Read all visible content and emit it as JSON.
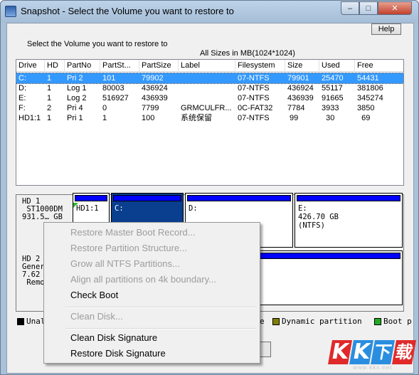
{
  "window": {
    "title": "Snapshot - Select the Volume you want to restore to",
    "minimize": "–",
    "maximize": "□",
    "close": "✕"
  },
  "help_label": "Help",
  "subtitle": "Select the Volume you want to restore to",
  "sizes_note": "All Sizes in MB(1024*1024)",
  "columns": [
    "Drive",
    "HD",
    "PartNo",
    "PartSt...",
    "PartSize",
    "Label",
    "Filesystem",
    "Size",
    "Used",
    "Free"
  ],
  "rows": [
    [
      "C:",
      "1",
      "Pri  2",
      "101",
      "79902",
      "",
      "07-NTFS",
      "79901",
      "25470",
      "54431"
    ],
    [
      "D:",
      "1",
      "Log  1",
      "80003",
      "436924",
      "",
      "07-NTFS",
      "436924",
      "55117",
      "381806"
    ],
    [
      "E:",
      "1",
      "Log  2",
      "516927",
      "436939",
      "",
      "07-NTFS",
      "436939",
      "91665",
      "345274"
    ],
    [
      "F:",
      "2",
      "Pri  4",
      "0",
      "7799",
      "GRMCULFR...",
      "0C-FAT32",
      "7784",
      "3933",
      "3850"
    ],
    [
      "HD1:1",
      "1",
      "Pri  1",
      "1",
      "100",
      "系统保留",
      "07-NTFS",
      " 99",
      "  30",
      "  69"
    ]
  ],
  "disks": {
    "hd1_label": "HD 1\n ST1000DM\n931.5… GB",
    "hd2_label": "HD 2\nGener\n7.62\n Remo",
    "part_hd1_1": "HD1:1",
    "part_c": "C:",
    "part_d": "D:",
    "part_e": "E:\n426.70 GB\n(NTFS)"
  },
  "legend": {
    "unallocated": "Unal",
    "e_fragment": "e",
    "dynamic": "Dynamic partition",
    "boot": "Boot p"
  },
  "legend_colors": {
    "unallocated": "#000000",
    "dynamic": "#808000",
    "boot": "#22aa22"
  },
  "context_menu": {
    "restore_mbr": "Restore Master Boot Record...",
    "restore_partition_structure": "Restore Partition Structure...",
    "grow_ntfs": "Grow all NTFS Partitions...",
    "align_4k": "Align all partitions on 4k boundary...",
    "check_boot": "Check Boot",
    "clean_disk": "Clean Disk...",
    "clean_signature": "Clean Disk Signature",
    "restore_signature": "Restore Disk Signature"
  },
  "watermark": {
    "letters": [
      "K",
      "K",
      "下",
      "载"
    ],
    "url": "www.kkx.net"
  }
}
